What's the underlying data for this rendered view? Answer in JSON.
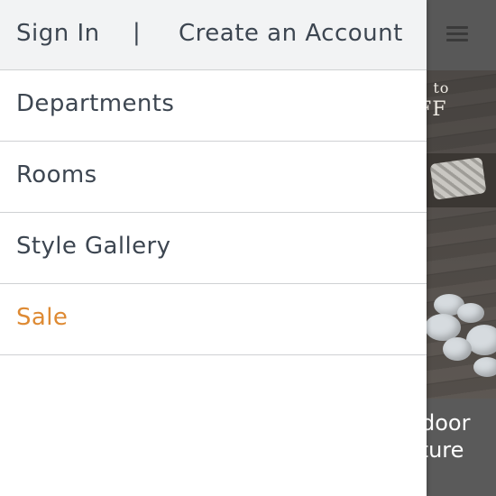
{
  "header": {
    "sign_in_label": "Sign In",
    "separator": "|",
    "create_account_label": "Create an Account"
  },
  "menu": {
    "items": [
      {
        "label": "Departments"
      },
      {
        "label": "Rooms"
      },
      {
        "label": "Style Gallery"
      },
      {
        "label": "Sale"
      }
    ]
  },
  "background": {
    "menu_icon": "hamburger-menu-icon",
    "promo_line1": "p to",
    "promo_line2": "FF",
    "caption_line1": "door",
    "caption_line2": "iture"
  },
  "colors": {
    "drawer_header_bg": "#f2f3f4",
    "text": "#3d4651",
    "sale_accent": "#de8a33",
    "divider": "#cfd1d3"
  }
}
